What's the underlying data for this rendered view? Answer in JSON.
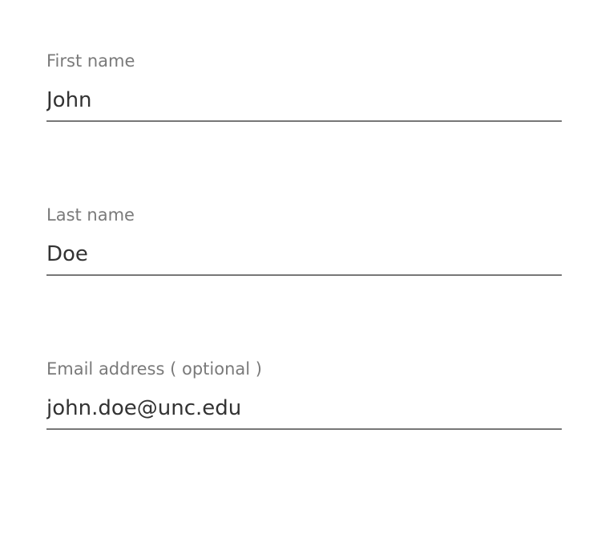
{
  "form": {
    "fields": [
      {
        "label": "First name",
        "value": "John"
      },
      {
        "label": "Last name",
        "value": "Doe"
      },
      {
        "label": "Email address ( optional )",
        "value": "john.doe@unc.edu"
      }
    ]
  },
  "colors": {
    "label": "#7a7a7a",
    "value": "#333333",
    "underline": "#777777",
    "background": "#ffffff"
  }
}
